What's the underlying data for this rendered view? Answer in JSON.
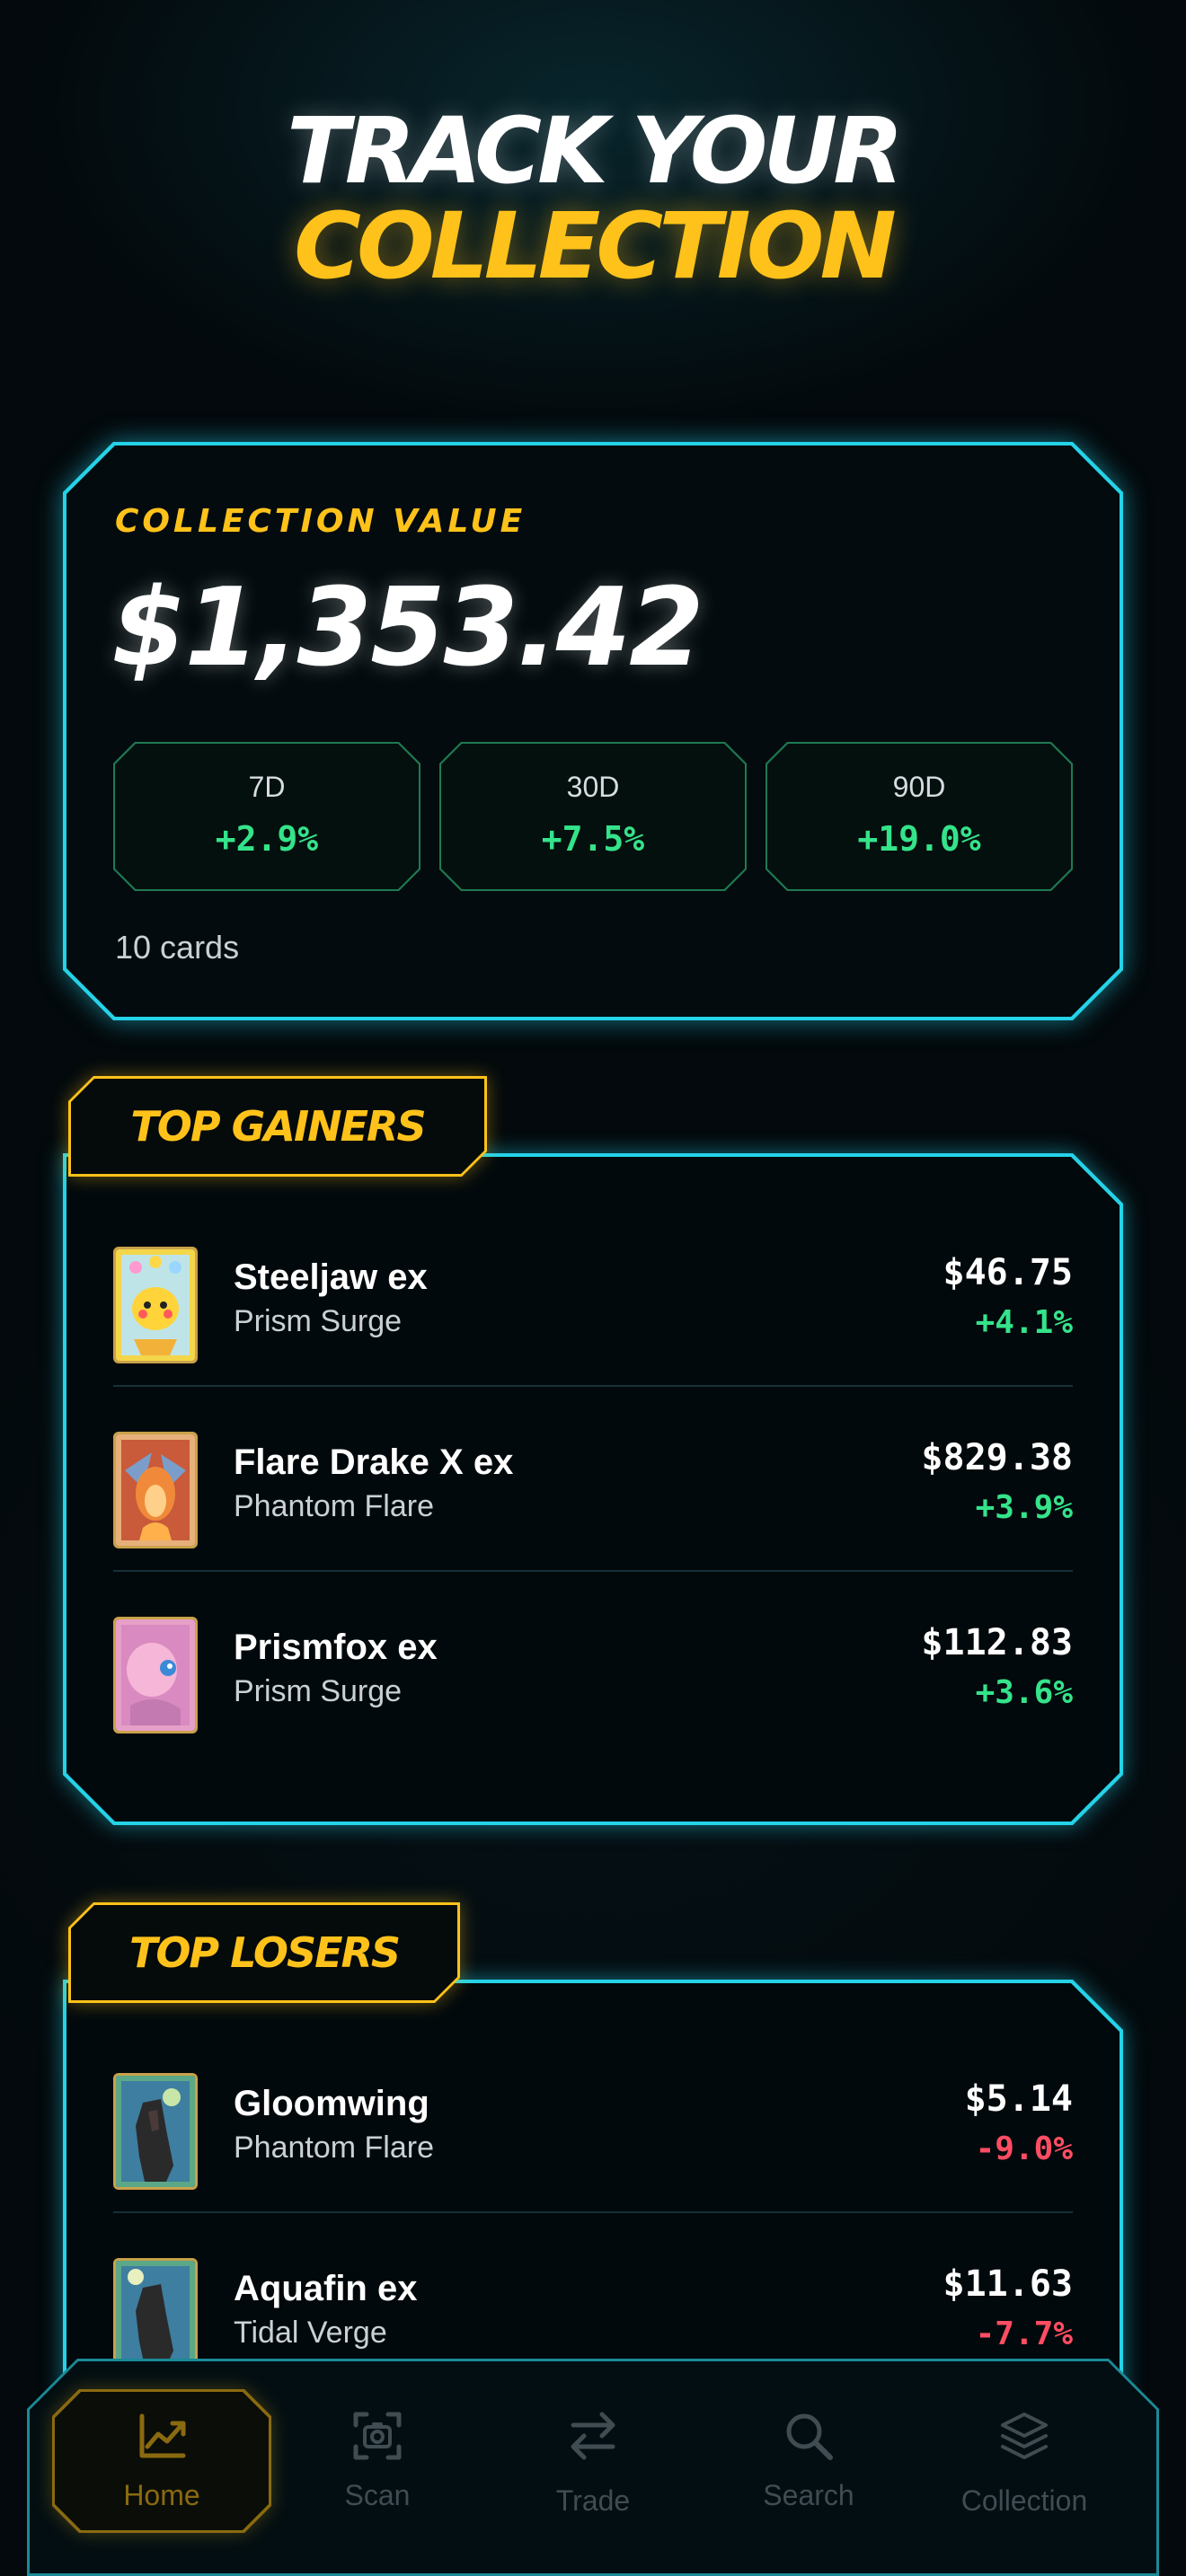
{
  "hero": {
    "line1": "TRACK YOUR",
    "line2": "COLLECTION"
  },
  "collection": {
    "label": "COLLECTION VALUE",
    "value": "$1,353.42",
    "stats": [
      {
        "period": "7D",
        "change": "+2.9%"
      },
      {
        "period": "30D",
        "change": "+7.5%"
      },
      {
        "period": "90D",
        "change": "+19.0%"
      }
    ],
    "count": "10 cards"
  },
  "gainers": {
    "title": "TOP GAINERS",
    "items": [
      {
        "name": "Steeljaw ex",
        "set": "Prism Surge",
        "price": "$46.75",
        "change": "+4.1%"
      },
      {
        "name": "Flare Drake X ex",
        "set": "Phantom Flare",
        "price": "$829.38",
        "change": "+3.9%"
      },
      {
        "name": "Prismfox ex",
        "set": "Prism Surge",
        "price": "$112.83",
        "change": "+3.6%"
      }
    ]
  },
  "losers": {
    "title": "TOP LOSERS",
    "items": [
      {
        "name": "Gloomwing",
        "set": "Phantom Flare",
        "price": "$5.14",
        "change": "-9.0%"
      },
      {
        "name": "Aquafin ex",
        "set": "Tidal Verge",
        "price": "$11.63",
        "change": "-7.7%"
      }
    ]
  },
  "nav": {
    "items": [
      {
        "label": "Home",
        "icon": "chart-icon",
        "active": true
      },
      {
        "label": "Scan",
        "icon": "camera-icon",
        "active": false
      },
      {
        "label": "Trade",
        "icon": "swap-icon",
        "active": false
      },
      {
        "label": "Search",
        "icon": "search-icon",
        "active": false
      },
      {
        "label": "Collection",
        "icon": "layers-icon",
        "active": false
      }
    ]
  },
  "colors": {
    "accent_cyan": "#24d3e8",
    "accent_gold": "#ffc21a",
    "gain_green": "#34e38a",
    "loss_red": "#ff4d63",
    "background": "#03090c"
  }
}
